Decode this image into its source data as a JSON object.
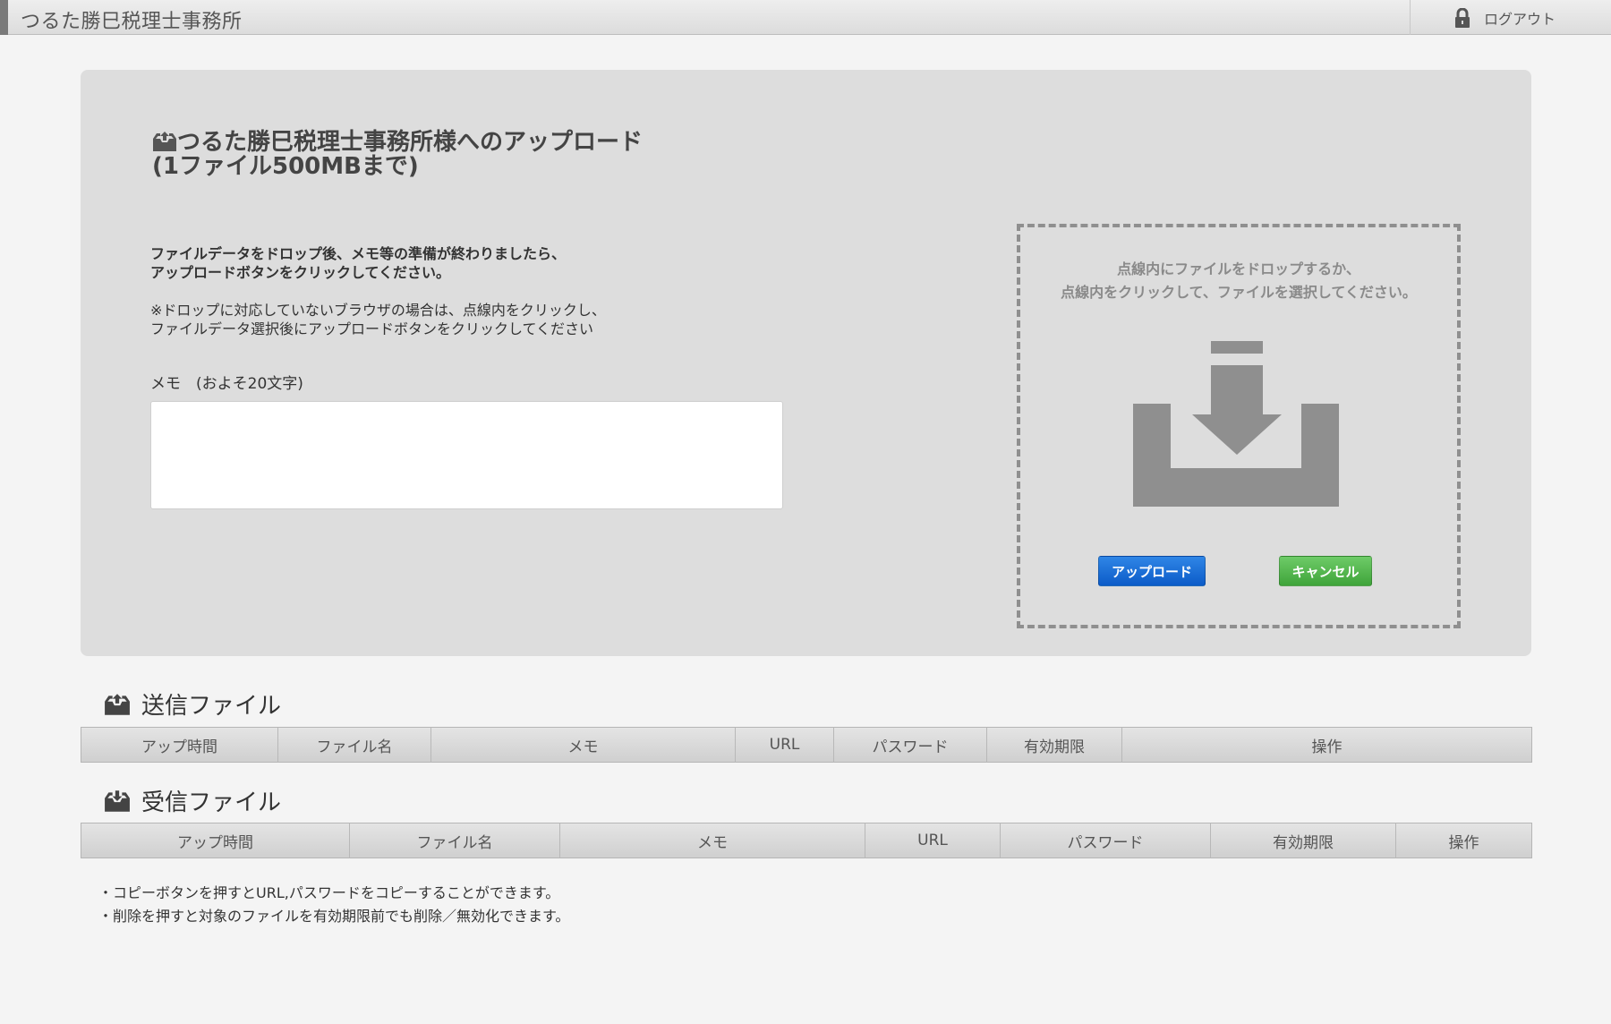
{
  "header": {
    "site_title": "つるた勝巳税理士事務所",
    "logout_label": "ログアウト"
  },
  "upload": {
    "title_line1": "つるた勝巳税理士事務所様へのアップロード",
    "title_line2": "(1ファイル500MBまで)",
    "instruction_line1": "ファイルデータをドロップ後、メモ等の準備が終わりましたら、",
    "instruction_line2": "アップロードボタンをクリックしてください。",
    "note_line1": "※ドロップに対応していないブラウザの場合は、点線内をクリックし、",
    "note_line2": "ファイルデータ選択後にアップロードボタンをクリックしてください",
    "memo_label": "メモ　(およそ20文字)",
    "memo_value": "",
    "dropzone_line1": "点線内にファイルをドロップするか、",
    "dropzone_line2": "点線内をクリックして、ファイルを選択してください。",
    "upload_button": "アップロード",
    "cancel_button": "キャンセル"
  },
  "sent": {
    "heading": "送信ファイル",
    "columns": [
      "アップ時間",
      "ファイル名",
      "メモ",
      "URL",
      "パスワード",
      "有効期限",
      "操作"
    ]
  },
  "received": {
    "heading": "受信ファイル",
    "columns": [
      "アップ時間",
      "ファイル名",
      "メモ",
      "URL",
      "パスワード",
      "有効期限",
      "操作"
    ]
  },
  "footnotes": {
    "line1": "・コピーボタンを押すとURL,パスワードをコピーすることができます。",
    "line2": "・削除を押すと対象のファイルを有効期限前でも削除／無効化できます。"
  },
  "colors": {
    "upload_button": "#0c5bc8",
    "cancel_button": "#3fa43a",
    "panel_bg": "#dddddd"
  }
}
